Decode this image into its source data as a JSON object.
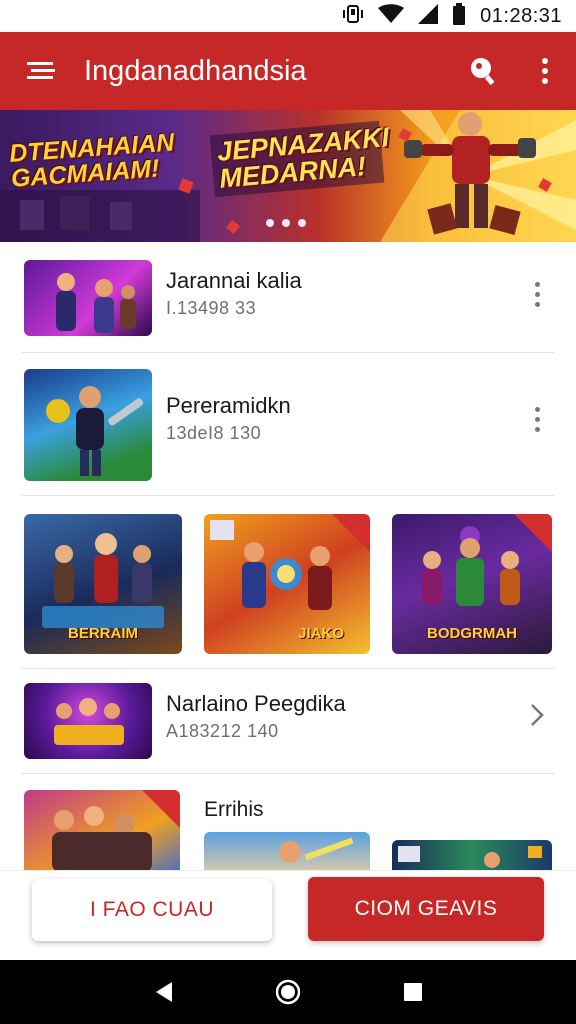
{
  "status_bar": {
    "time": "01:28:31"
  },
  "app_bar": {
    "title": "Ingdanadhandsia"
  },
  "banner": {
    "headline_left": "DTENAHAIAN GACMAIAM!",
    "headline_right": "JEPNAZAKKI MEDARNA!",
    "dot_count": 3
  },
  "feed": {
    "list_items": [
      {
        "title": "Jarannai kalia",
        "subtitle": "I.13498 33"
      },
      {
        "title": "Pereramidkn",
        "subtitle": "13deI8 130"
      }
    ],
    "cards": [
      {
        "caption": "BERRAIM"
      },
      {
        "caption": "JIAKO"
      },
      {
        "caption": "BODGRMAH"
      }
    ],
    "list_item_3": {
      "title": "Narlaino Peegdika",
      "subtitle": "A183212 140"
    },
    "section_title": "Errihis"
  },
  "bottom_buttons": {
    "secondary_label": "I FAO CUAU",
    "primary_label": "CIOM GEAVIS"
  },
  "colors": {
    "accent": "#c62828",
    "app_bar": "#c62828",
    "nav_bar": "#000000"
  }
}
